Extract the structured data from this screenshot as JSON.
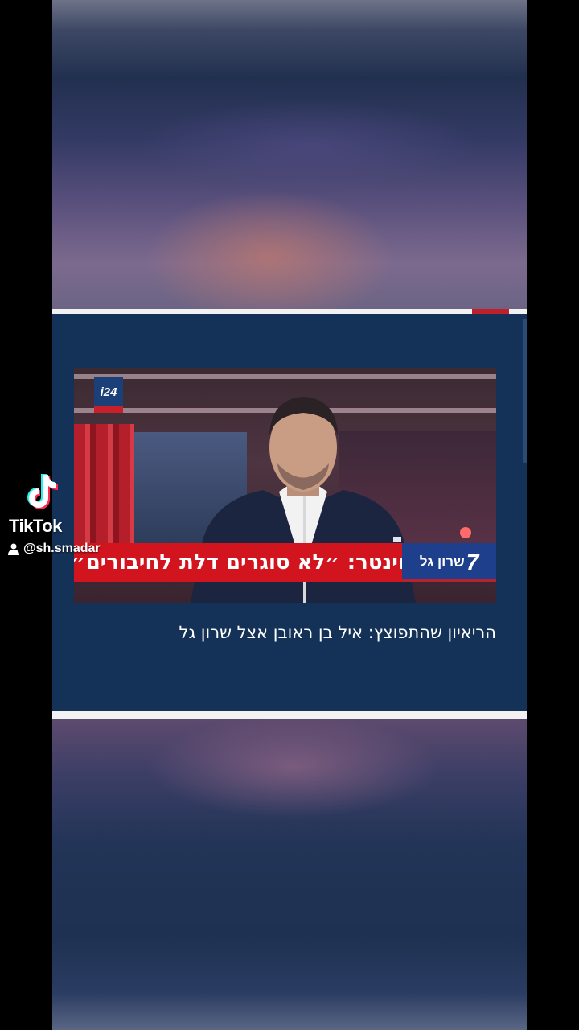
{
  "watermark": {
    "brand": "TikTok",
    "username": "@sh.smadar"
  },
  "post": {
    "news_still": {
      "channel_logo": "i24",
      "headline": "וינטר: ״לא סוגרים דלת לחיבורים״",
      "show_name": "שרון גל",
      "show_number": "7"
    },
    "caption": "הריאיון שהתפוצץ: איל בן ראובן אצל שרון גל"
  },
  "colors": {
    "panel_background": "#143257",
    "headline_red": "#d2141e",
    "show_blue": "#1d3f8c"
  },
  "icons": [
    "tiktok-logo-icon",
    "user-icon"
  ]
}
